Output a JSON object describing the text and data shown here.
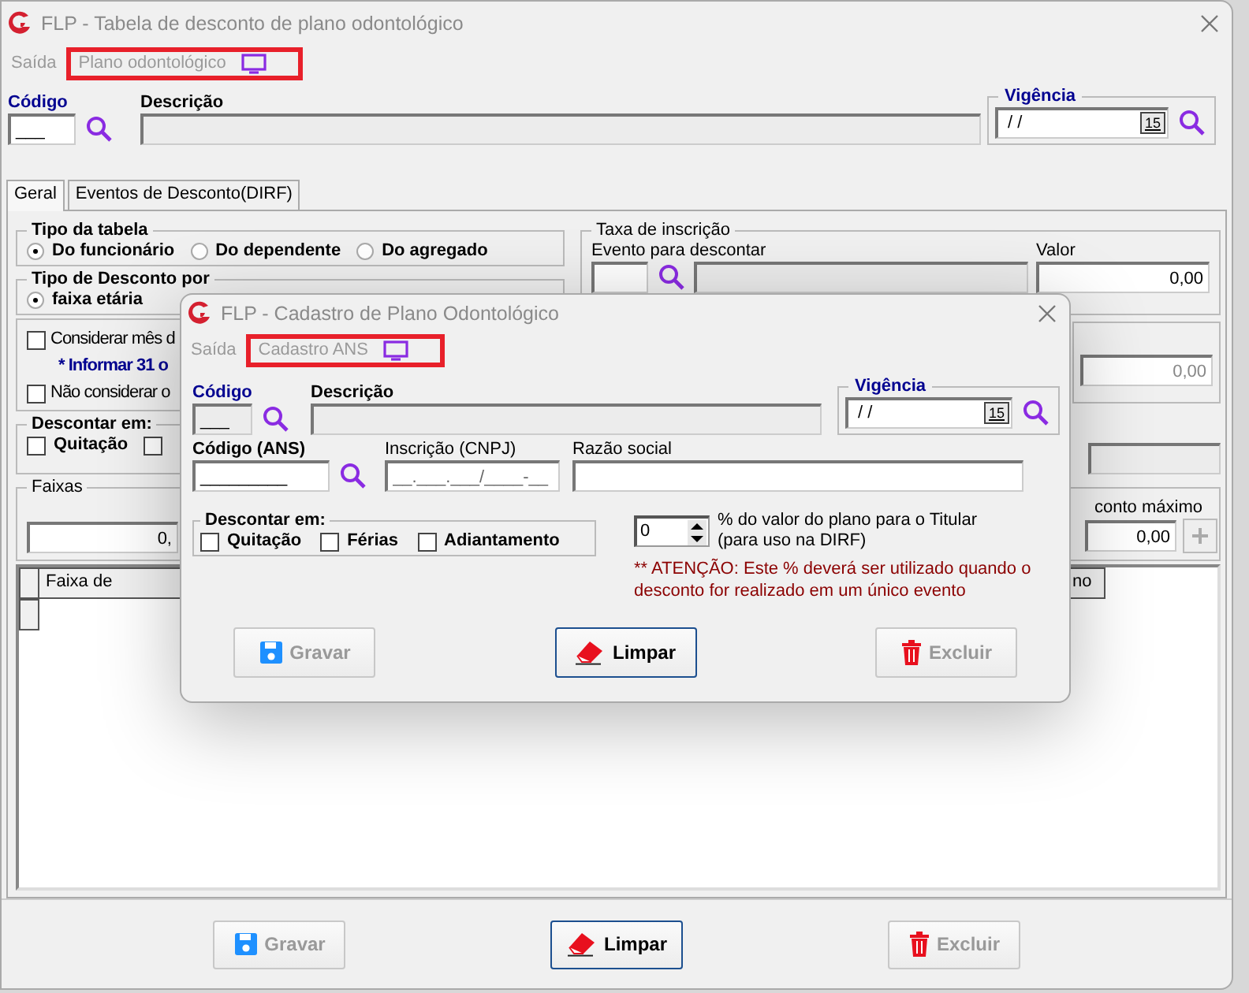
{
  "main": {
    "title": "FLP - Tabela de desconto de plano odontológico",
    "menu": [
      {
        "label": "Saída",
        "highlighted": false
      },
      {
        "label": "Plano odontológico",
        "highlighted": true,
        "icon": true
      }
    ],
    "codigo": {
      "label": "Código",
      "value": "___"
    },
    "descricao": {
      "label": "Descrição"
    },
    "vigencia": {
      "label": "Vigência",
      "value": "/  /",
      "calendar": "15"
    },
    "tabs": [
      {
        "label": "Geral",
        "selected": true
      },
      {
        "label": "Eventos de Desconto(DIRF)",
        "selected": false
      }
    ],
    "tipo_tabela": {
      "title": "Tipo da tabela",
      "options": [
        {
          "label": "Do funcionário",
          "selected": true
        },
        {
          "label": "Do dependente",
          "selected": false
        },
        {
          "label": "Do agregado",
          "selected": false
        }
      ]
    },
    "tipo_desconto": {
      "title": "Tipo de Desconto por",
      "options": [
        {
          "label": "faixa etária",
          "selected": true
        }
      ]
    },
    "taxa": {
      "title": "Taxa de inscrição",
      "evento_label": "Evento para descontar",
      "valor_label": "Valor",
      "valor": "0,00"
    },
    "opcoes": [
      {
        "kind": "checkbox",
        "label": "Considerar mês d",
        "checked": false
      },
      {
        "kind": "note",
        "label": "* Informar 31 o"
      },
      {
        "kind": "checkbox",
        "label": "Não considerar o",
        "checked": false
      }
    ],
    "opcoes_valor": "0,00",
    "descontar": {
      "title": "Descontar em:",
      "options": [
        {
          "label": "Quitação",
          "checked": false
        },
        {
          "checked": false
        }
      ]
    },
    "faixas": {
      "title": "Faixas",
      "valor": "0,",
      "maximo_label": "conto máximo",
      "maximo": "0,00"
    },
    "grid": {
      "columns": [
        "Faixa de",
        "no"
      ]
    },
    "buttons": [
      {
        "kind": "save",
        "label": "Gravar",
        "disabled": true
      },
      {
        "kind": "clear",
        "label": "Limpar",
        "disabled": false
      },
      {
        "kind": "delete",
        "label": "Excluir",
        "disabled": true
      }
    ]
  },
  "dialog": {
    "title": "FLP - Cadastro de Plano Odontológico",
    "menu": [
      {
        "label": "Saída",
        "highlighted": false
      },
      {
        "label": "Cadastro ANS",
        "highlighted": true,
        "icon": true
      }
    ],
    "codigo": {
      "label": "Código",
      "value": "___"
    },
    "descricao": {
      "label": "Descrição"
    },
    "vigencia": {
      "label": "Vigência",
      "value": "/  /",
      "calendar": "15"
    },
    "ans": {
      "label": "Código (ANS)",
      "value": "_________"
    },
    "cnpj": {
      "label": "Inscrição (CNPJ)",
      "placeholder": "__.___.___/____-__"
    },
    "razao": {
      "label": "Razão social"
    },
    "descontar": {
      "title": "Descontar em:",
      "options": [
        {
          "label": "Quitação",
          "checked": false
        },
        {
          "label": "Férias",
          "checked": false
        },
        {
          "label": "Adiantamento",
          "checked": false
        }
      ]
    },
    "percent": {
      "value": "0",
      "line1": "% do valor do plano para o Titular",
      "line2": "(para uso na DIRF)"
    },
    "warning": "** ATENÇÃO: Este % deverá ser utilizado quando o desconto for realizado em um único evento",
    "buttons": [
      {
        "kind": "save",
        "label": "Gravar",
        "disabled": true
      },
      {
        "kind": "clear",
        "label": "Limpar",
        "disabled": false
      },
      {
        "kind": "delete",
        "label": "Excluir",
        "disabled": true
      }
    ]
  }
}
